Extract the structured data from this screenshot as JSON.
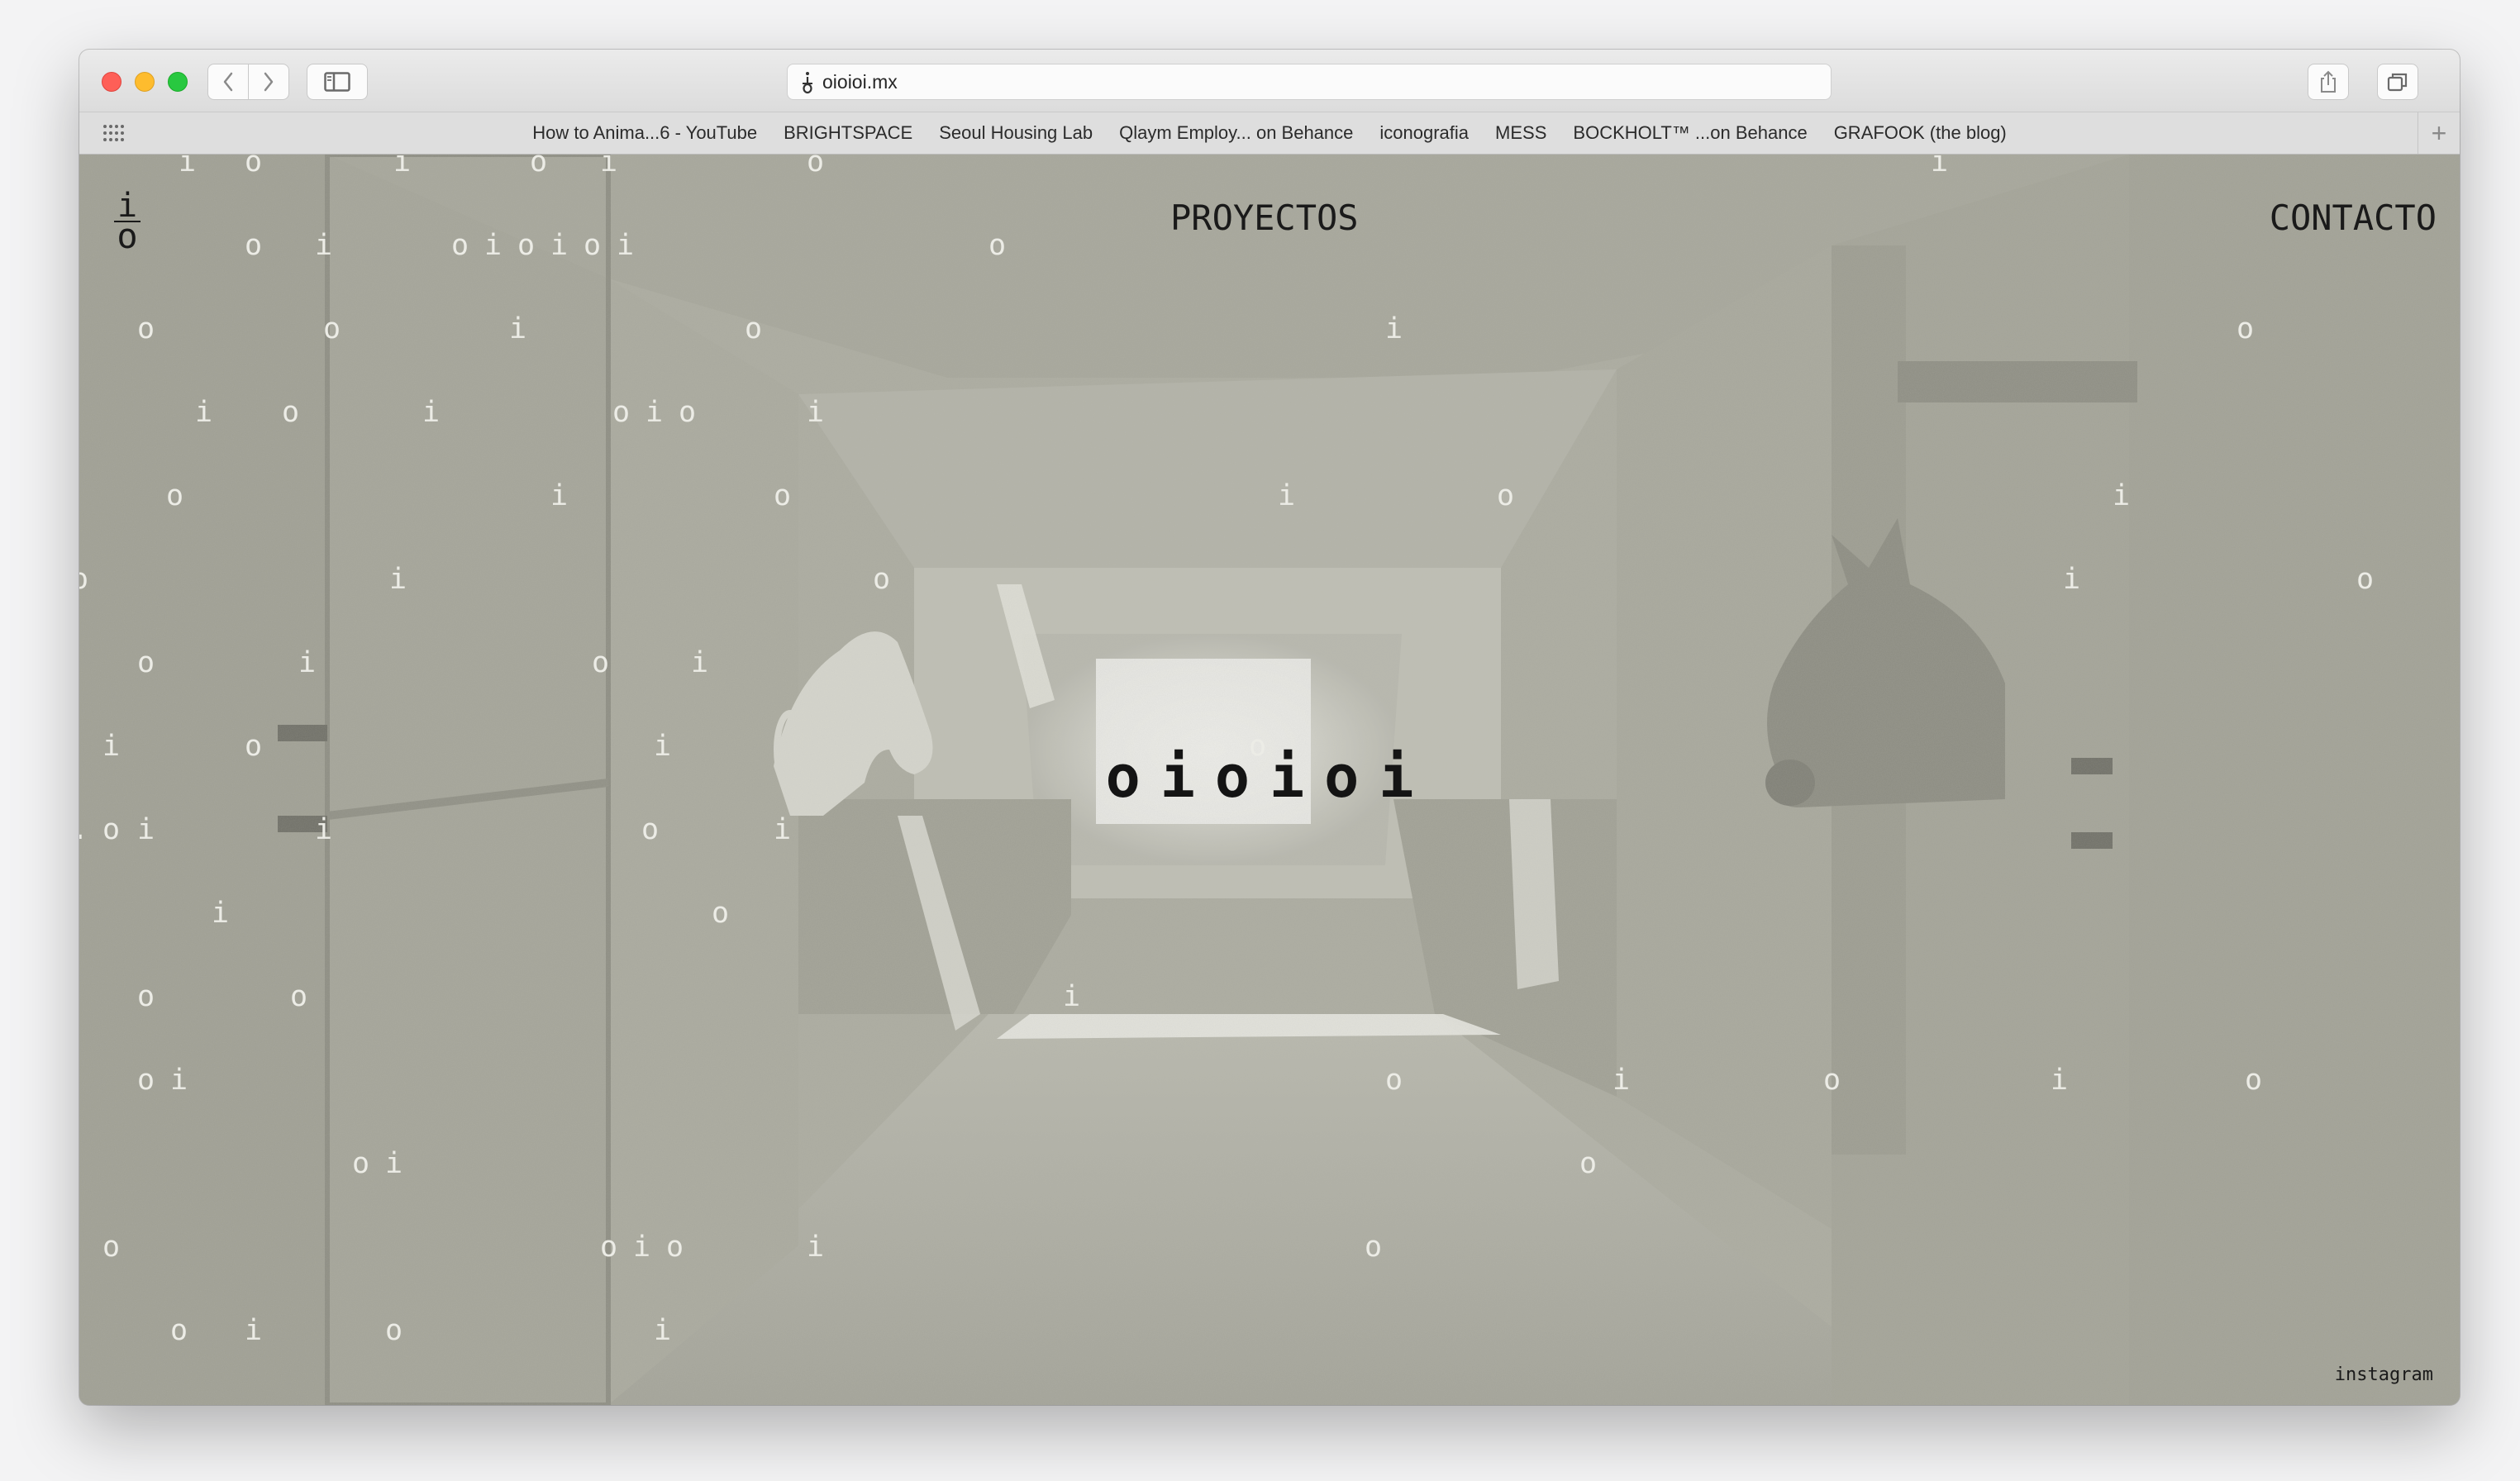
{
  "browser": {
    "url": "oioioi.mx",
    "bookmarks": [
      "How to Anima...6 - YouTube",
      "BRIGHTSPACE",
      "Seoul Housing Lab",
      "Qlaym Employ... on Behance",
      "iconografia",
      "MESS",
      "BOCKHOLT™ ...on Behance",
      "GRAFOOK (the blog)"
    ],
    "new_tab_glyph": "+"
  },
  "site": {
    "logo_top": "i",
    "logo_bottom": "o",
    "nav_projects": "PROYECTOS",
    "nav_contact": "CONTACTO",
    "brand": "oioioi",
    "instagram": "instagram",
    "hero_description": "monochrome photo of a concrete stable corridor with horses looking out of stalls"
  },
  "colors": {
    "traffic_close": "#fe5f57",
    "traffic_minimize": "#febc2e",
    "traffic_zoom": "#28c840",
    "page_tint": "#abab9f",
    "rain_char": "#ecece6",
    "text": "#1a1a1a"
  },
  "icons": [
    "chevron-left-icon",
    "chevron-right-icon",
    "sidebar-icon",
    "site-logo-icon",
    "grid-icon",
    "share-icon",
    "tabs-icon",
    "plus-icon"
  ]
}
